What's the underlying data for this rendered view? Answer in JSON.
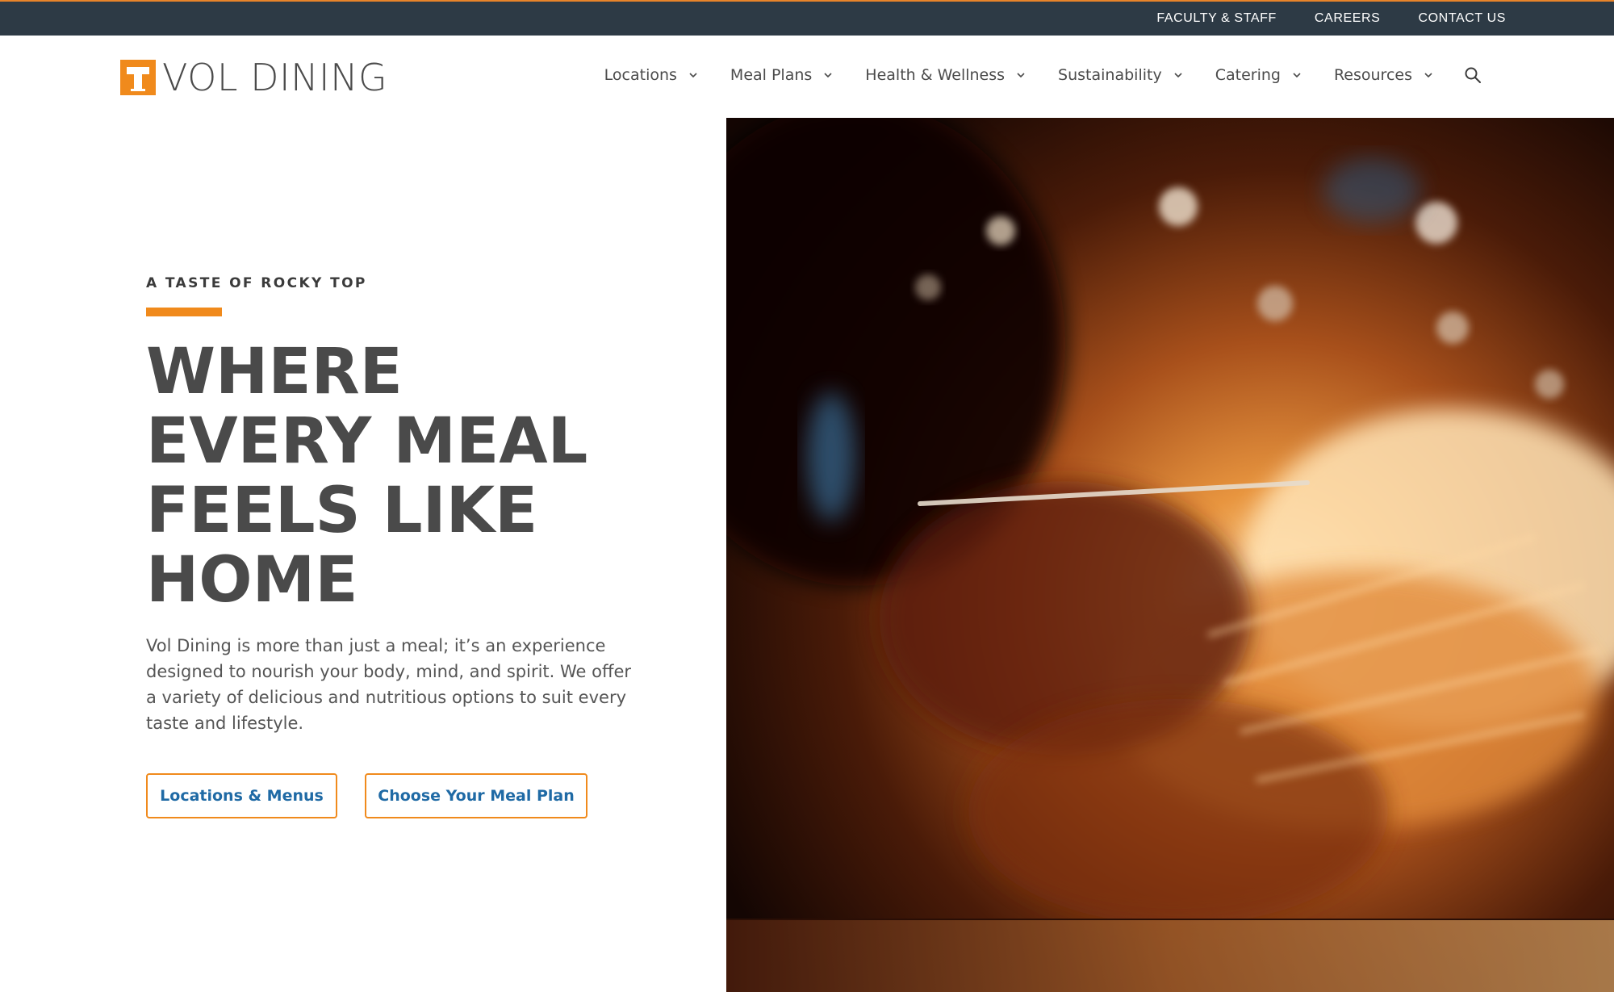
{
  "utility_nav": {
    "items": [
      "FACULTY & STAFF",
      "CAREERS",
      "CONTACT US"
    ]
  },
  "header": {
    "logo_letter": "T",
    "logo_text": "VOL DINING",
    "nav": [
      {
        "label": "Locations"
      },
      {
        "label": "Meal Plans"
      },
      {
        "label": "Health & Wellness"
      },
      {
        "label": "Sustainability"
      },
      {
        "label": "Catering"
      },
      {
        "label": "Resources"
      }
    ]
  },
  "hero": {
    "eyebrow": "A TASTE OF ROCKY TOP",
    "headline_lines": [
      "WHERE",
      "EVERY MEAL",
      "FEELS LIKE",
      "HOME"
    ],
    "intro": "Vol Dining is more than just a meal; it’s an experience designed to nourish your body, mind, and spirit. We offer a variety of delicious and nutritious options to suit every taste and lifestyle.",
    "buttons": [
      {
        "label": "Locations & Menus"
      },
      {
        "label": "Choose Your Meal Plan"
      }
    ]
  },
  "colors": {
    "accent": "#f08a1c",
    "utility_bg": "#2d3a45",
    "link_blue": "#1f6aa5",
    "heading": "#4a4a4a"
  },
  "icons": [
    "chevron-down-icon",
    "search-icon"
  ]
}
